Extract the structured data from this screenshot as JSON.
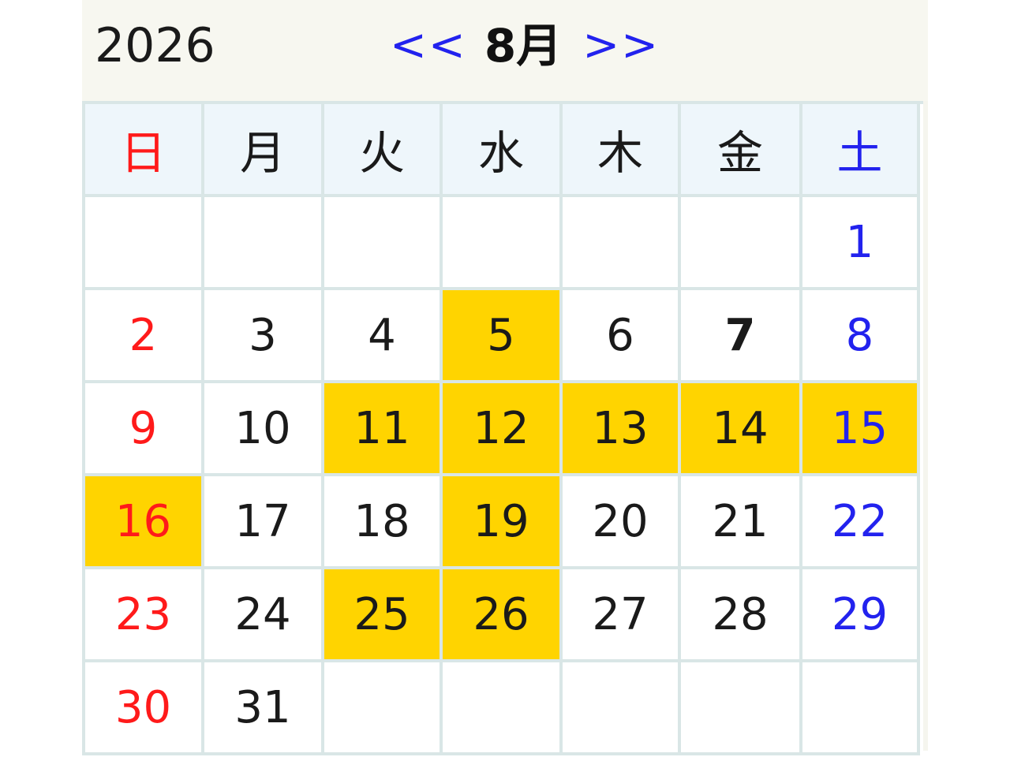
{
  "calendar": {
    "year": "2026",
    "prev_label": "<<",
    "month_label": "8月",
    "next_label": ">>",
    "weekdays": [
      "日",
      "月",
      "火",
      "水",
      "木",
      "金",
      "土"
    ],
    "weeks": [
      [
        {
          "day": ""
        },
        {
          "day": ""
        },
        {
          "day": ""
        },
        {
          "day": ""
        },
        {
          "day": ""
        },
        {
          "day": ""
        },
        {
          "day": "1"
        }
      ],
      [
        {
          "day": "2"
        },
        {
          "day": "3"
        },
        {
          "day": "4"
        },
        {
          "day": "5",
          "highlight": true
        },
        {
          "day": "6"
        },
        {
          "day": "7",
          "today": true
        },
        {
          "day": "8"
        }
      ],
      [
        {
          "day": "9"
        },
        {
          "day": "10"
        },
        {
          "day": "11",
          "highlight": true
        },
        {
          "day": "12",
          "highlight": true
        },
        {
          "day": "13",
          "highlight": true
        },
        {
          "day": "14",
          "highlight": true
        },
        {
          "day": "15",
          "highlight": true
        }
      ],
      [
        {
          "day": "16",
          "highlight": true
        },
        {
          "day": "17"
        },
        {
          "day": "18"
        },
        {
          "day": "19",
          "highlight": true
        },
        {
          "day": "20"
        },
        {
          "day": "21"
        },
        {
          "day": "22"
        }
      ],
      [
        {
          "day": "23"
        },
        {
          "day": "24"
        },
        {
          "day": "25",
          "highlight": true
        },
        {
          "day": "26",
          "highlight": true
        },
        {
          "day": "27"
        },
        {
          "day": "28"
        },
        {
          "day": "29"
        }
      ],
      [
        {
          "day": "30"
        },
        {
          "day": "31"
        },
        {
          "day": ""
        },
        {
          "day": ""
        },
        {
          "day": ""
        },
        {
          "day": ""
        },
        {
          "day": ""
        }
      ]
    ],
    "colors": {
      "sunday": "#ff1a1a",
      "saturday": "#2222ee",
      "highlight": "#ffd400",
      "nav_link": "#2222ee"
    }
  }
}
